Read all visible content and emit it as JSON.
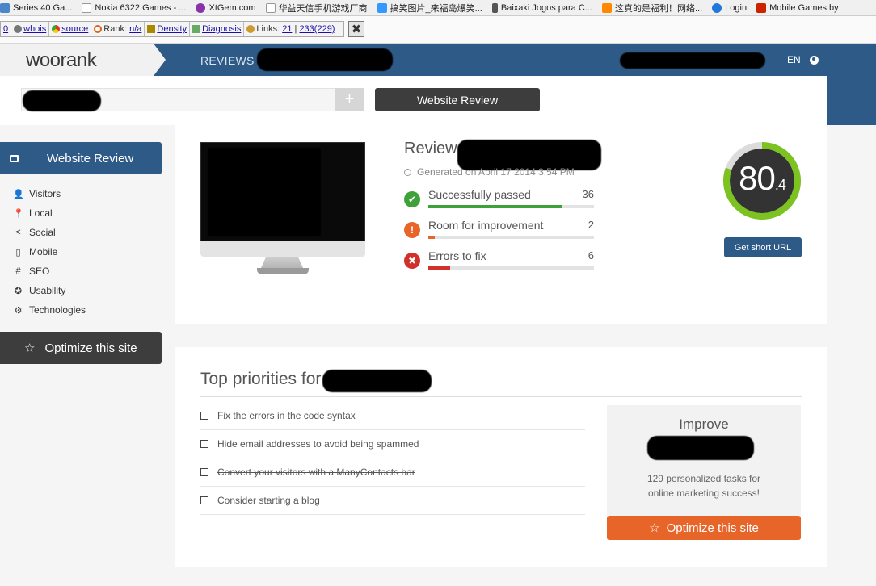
{
  "bookmarks": [
    {
      "label": "Series 40 Ga...",
      "icon": "page-icon",
      "color": "#4a86c8"
    },
    {
      "label": "Nokia 6322 Games - ...",
      "icon": "page-icon",
      "color": "#ffffff"
    },
    {
      "label": "XtGem.com",
      "icon": "xtgem-icon",
      "color": "#8833aa"
    },
    {
      "label": "华益天信手机游戏厂商",
      "icon": "page-icon",
      "color": "#ffffff"
    },
    {
      "label": "搞笑图片_来福岛爆笑...",
      "icon": "site-icon",
      "color": "#3399ff"
    },
    {
      "label": "Baixaki Jogos para C...",
      "icon": "phone-icon",
      "color": "#555555"
    },
    {
      "label": "这真的是福利！网络...",
      "icon": "site-icon",
      "color": "#ff8800"
    },
    {
      "label": "Login",
      "icon": "fingerprint-icon",
      "color": "#2277dd"
    },
    {
      "label": "Mobile Games by",
      "icon": "site-icon",
      "color": "#cc2200"
    }
  ],
  "seo_toolbar": {
    "page_count": "0",
    "whois": "whois",
    "source": "source",
    "rank_label": "Rank:",
    "rank_value": "n/a",
    "density": "Density",
    "diagnosis": "Diagnosis",
    "links_label": "Links:",
    "links_value": "21",
    "links_sep": "|",
    "links_total": "233(229)",
    "close_glyph": "✖"
  },
  "header": {
    "logo": "woorank",
    "nav_reviews": "REVIEWS",
    "lang": "EN"
  },
  "search": {
    "plus": "+",
    "button": "Website Review"
  },
  "sidebar": {
    "title": "Website Review",
    "items": [
      {
        "label": "Visitors",
        "icon": "person-icon",
        "glyph": "👤"
      },
      {
        "label": "Local",
        "icon": "map-pin-icon",
        "glyph": "📍"
      },
      {
        "label": "Social",
        "icon": "share-icon",
        "glyph": "<"
      },
      {
        "label": "Mobile",
        "icon": "mobile-icon",
        "glyph": "▯"
      },
      {
        "label": "SEO",
        "icon": "hash-icon",
        "glyph": "#"
      },
      {
        "label": "Usability",
        "icon": "lifebuoy-icon",
        "glyph": "✪"
      },
      {
        "label": "Technologies",
        "icon": "gear-icon",
        "glyph": "⚙"
      }
    ],
    "optimize": "Optimize this site"
  },
  "review": {
    "title": "Review",
    "generated": "Generated on April 17 2014 3:54 PM",
    "stats": [
      {
        "label": "Successfully passed",
        "count": "36",
        "color": "#3fa13a",
        "fill_pct": 81,
        "glyph": "✔",
        "icon": "check-circle-icon"
      },
      {
        "label": "Room for improvement",
        "count": "2",
        "color": "#e8652a",
        "fill_pct": 4,
        "glyph": "!",
        "icon": "warning-circle-icon"
      },
      {
        "label": "Errors to fix",
        "count": "6",
        "color": "#d0322b",
        "fill_pct": 13,
        "glyph": "✖",
        "icon": "error-circle-icon"
      }
    ],
    "score_int": "80",
    "score_dec": ".4",
    "score_value": 80.4,
    "score_color": "#7cc221",
    "short_url": "Get short URL"
  },
  "priorities": {
    "title": "Top priorities for",
    "tasks": [
      {
        "label": "Fix the errors in the code syntax",
        "done": false
      },
      {
        "label": "Hide email addresses to avoid being spammed",
        "done": false
      },
      {
        "label": "Convert your visitors with a ManyContacts bar",
        "done": true
      },
      {
        "label": "Consider starting a blog",
        "done": false
      }
    ]
  },
  "improve": {
    "title": "Improve",
    "desc": "129 personalized tasks for online marketing success!",
    "button": "Optimize this site"
  },
  "colors": {
    "brand_blue": "#2d5a87",
    "dark_button": "#3d3d3d",
    "orange": "#e8652a",
    "score_green": "#7cc221"
  }
}
